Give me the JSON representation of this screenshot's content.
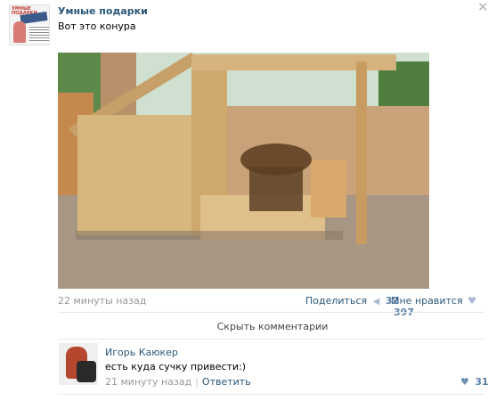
{
  "post": {
    "author": "Умные подарки",
    "text": "Вот это конура",
    "time": "22 минуты назад",
    "share_label": "Поделиться",
    "share_count": "32",
    "like_label": "Мне нравится",
    "like_count": "397",
    "avatar_brand": "УМНЫЕ ПОДАРКИ"
  },
  "comments_toggle": "Скрыть комментарии",
  "comment": {
    "author": "Игорь Каюкер",
    "text": "есть куда сучку привести:)",
    "time": "21 минуту назад",
    "reply_label": "Ответить",
    "like_count": "31"
  },
  "icons": {
    "close": "close-icon",
    "share": "megaphone-icon",
    "like": "heart-icon"
  }
}
